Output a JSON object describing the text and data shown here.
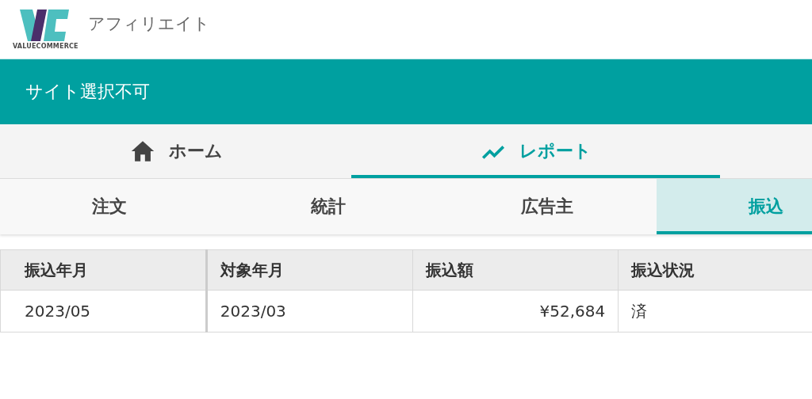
{
  "header": {
    "logo_text": "VALUECOMMERCE",
    "title": "アフィリエイト"
  },
  "site_bar": {
    "label": "サイト選択不可"
  },
  "main_tabs": [
    {
      "label": "ホーム",
      "kind": "home",
      "selected": false
    },
    {
      "label": "レポート",
      "kind": "trend",
      "selected": true
    }
  ],
  "sub_tabs": [
    {
      "label": "注文",
      "selected": false
    },
    {
      "label": "統計",
      "selected": false
    },
    {
      "label": "広告主",
      "selected": false
    },
    {
      "label": "振込",
      "selected": true
    }
  ],
  "table": {
    "columns": [
      "振込年月",
      "対象年月",
      "振込額",
      "振込状況"
    ],
    "rows": [
      [
        "2023/05",
        "2023/03",
        "¥52,684",
        "済"
      ]
    ]
  }
}
